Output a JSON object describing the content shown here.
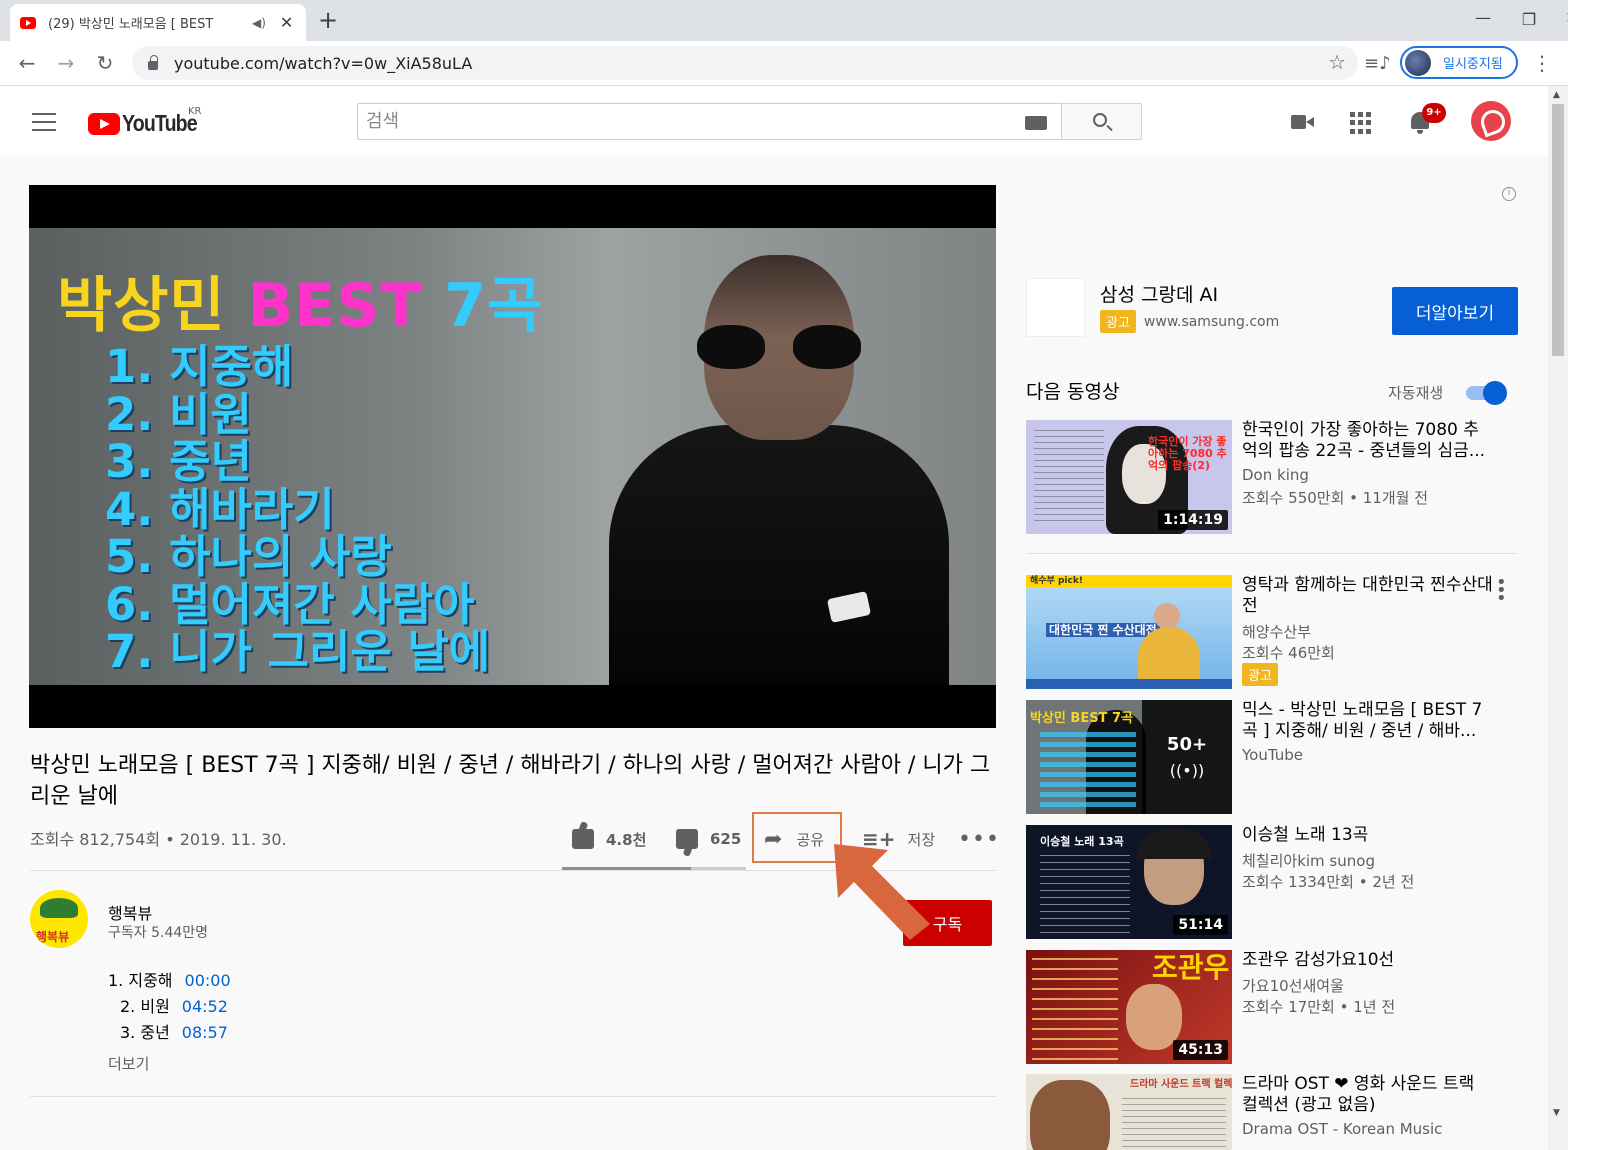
{
  "browser": {
    "tab_title": "(29) 박상민 노래모음 [ BEST",
    "audio_icon": "speaker-icon",
    "close_glyph": "✕",
    "new_tab_glyph": "+",
    "window_controls": [
      "—",
      "❐",
      "✕"
    ],
    "url": "youtube.com/watch?v=0w_XiA58uLA",
    "profile_label": "일시중지됨"
  },
  "masthead": {
    "logo_text": "YouTube",
    "region": "KR",
    "search_placeholder": "검색",
    "notification_count": "9+"
  },
  "player": {
    "thumb_heading": [
      "박상민 ",
      "BEST ",
      "7곡"
    ],
    "thumb_tracks": [
      "1. 지중해",
      "2. 비원",
      "3. 중년",
      "4. 해바라기",
      "5. 하나의 사랑",
      "6. 멀어져간 사람아",
      "7. 니가 그리운 날에"
    ]
  },
  "video": {
    "title": "박상민 노래모음 [ BEST 7곡 ] 지중해/ 비원 / 중년 / 해바라기 / 하나의 사랑 / 멀어져간 사람아 / 니가 그리운 날에",
    "views": "조회수 812,754회 • 2019. 11. 30.",
    "likes": "4.8천",
    "dislikes": "625",
    "like_ratio": 0.7,
    "share_label": "공유",
    "save_label": "저장",
    "more_glyph": "•••"
  },
  "channel": {
    "name": "행복뷰",
    "avatar_text": "행복뷰",
    "subscribers": "구독자 5.44만명",
    "subscribe_label": "구독"
  },
  "description": {
    "tracks": [
      {
        "label": "1. 지중해",
        "time": "00:00"
      },
      {
        "label": "2. 비원",
        "time": "04:52"
      },
      {
        "label": "3. 중년",
        "time": "08:57"
      }
    ],
    "more_label": "더보기"
  },
  "sidebar": {
    "info_glyph": "i",
    "ad": {
      "title": "삼성 그랑데 AI",
      "badge": "광고",
      "url": "www.samsung.com",
      "cta": "더알아보기"
    },
    "up_next": "다음 동영상",
    "autoplay": "자동재생",
    "autoplay_on": true,
    "recommendations": [
      {
        "title": "한국인이 가장 좋아하는 7080 추억의 팝송 22곡 - 중년들의 심금...",
        "channel": "Don king",
        "meta": "조회수 550만회 • 11개월 전",
        "duration": "1:14:19",
        "thumb_text": "한국인이 가장 좋아하는 7080 추억의 팝송(2)"
      },
      {
        "title": "영탁과 함께하는 대한민국 찐수산대전",
        "channel": "해양수산부",
        "meta": "조회수 46만회",
        "badge": "광고",
        "thumb_text": "대한민국 찐 수산대전",
        "thumb_corner": "해수부 pick!"
      },
      {
        "title": "믹스 - 박상민 노래모음 [ BEST 7곡 ] 지중해/ 비원 / 중년 / 해바...",
        "channel": "YouTube",
        "mix_count": "50+",
        "mix_icon": "((•))",
        "thumb_text": "박상민 BEST 7곡"
      },
      {
        "title": "이승철 노래 13곡",
        "channel": "체칠리아kim sunog",
        "meta": "조회수 1334만회 • 2년 전",
        "duration": "51:14",
        "thumb_text": "이승철 노래 13곡"
      },
      {
        "title": "조관우 감성가요10선",
        "channel": "가요10선새여울",
        "meta": "조회수 17만회 • 1년 전",
        "duration": "45:13",
        "thumb_text": "조관우"
      },
      {
        "title": "드라마 OST ❤ 영화 사운드 트랙 컬렉션 (광고 없음)",
        "channel": "Drama OST - Korean Music",
        "thumb_text": "드라마 사운드 트랙 컬렉션"
      }
    ]
  },
  "colors": {
    "yt_red": "#ff0000",
    "subscribe_red": "#cc0000",
    "link_blue": "#065fd4",
    "ad_yellow": "#f0b51f",
    "highlight_orange": "#e07b44"
  }
}
